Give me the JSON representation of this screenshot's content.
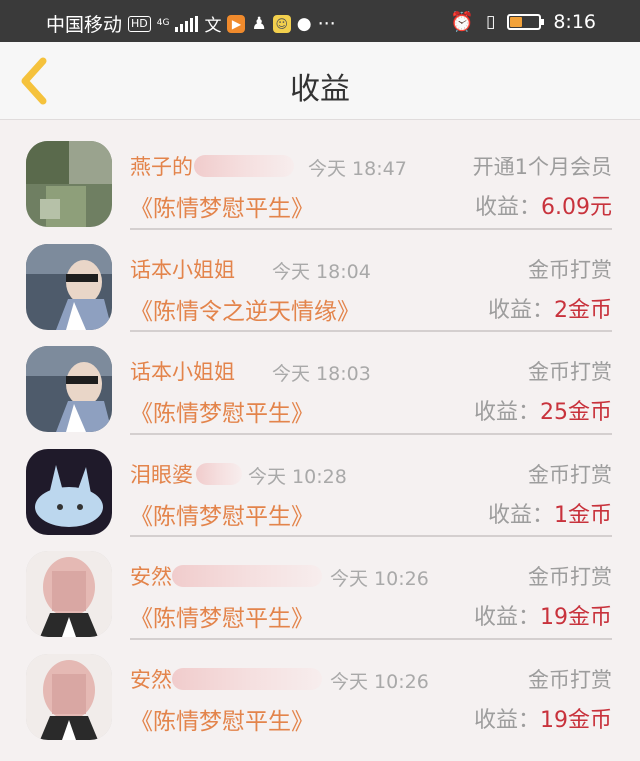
{
  "status_bar": {
    "carrier": "中国移动",
    "hd_badge": "HD",
    "network": "4G",
    "time": "8:16",
    "battery_level": 0.4,
    "icons": [
      "carrier-signal-icon",
      "wechat-icon",
      "video-app-icon",
      "qq-icon",
      "mini-app-icon",
      "chat-icon",
      "more-dots-icon",
      "alarm-icon",
      "vibrate-icon",
      "battery-icon"
    ],
    "more": "···"
  },
  "header": {
    "title": "收益",
    "back_icon": "chevron-left-icon",
    "accent": "#f5c23c"
  },
  "colors": {
    "name": "#e3844b",
    "book": "#e3844b",
    "value": "#c8323c",
    "muted": "#9d9d9d"
  },
  "items": [
    {
      "name": "燕子的",
      "time": "今天 18:47",
      "type": "开通1个月会员",
      "book": "《陈情梦慰平生》",
      "earn_label": "收益：",
      "earn_value": "6.09元"
    },
    {
      "name": "话本小姐姐",
      "time": "今天 18:04",
      "type": "金币打赏",
      "book": "《陈情令之逆天情缘》",
      "earn_label": "收益：",
      "earn_value": "2金币"
    },
    {
      "name": "话本小姐姐",
      "time": "今天 18:03",
      "type": "金币打赏",
      "book": "《陈情梦慰平生》",
      "earn_label": "收益：",
      "earn_value": "25金币"
    },
    {
      "name": "泪眼婆",
      "time": "今天 10:28",
      "type": "金币打赏",
      "book": "《陈情梦慰平生》",
      "earn_label": "收益：",
      "earn_value": "1金币"
    },
    {
      "name": "安然",
      "time": "今天 10:26",
      "type": "金币打赏",
      "book": "《陈情梦慰平生》",
      "earn_label": "收益：",
      "earn_value": "19金币"
    },
    {
      "name": "安然",
      "time": "今天 10:26",
      "type": "金币打赏",
      "book": "《陈情梦慰平生》",
      "earn_label": "收益：",
      "earn_value": "19金币"
    }
  ]
}
